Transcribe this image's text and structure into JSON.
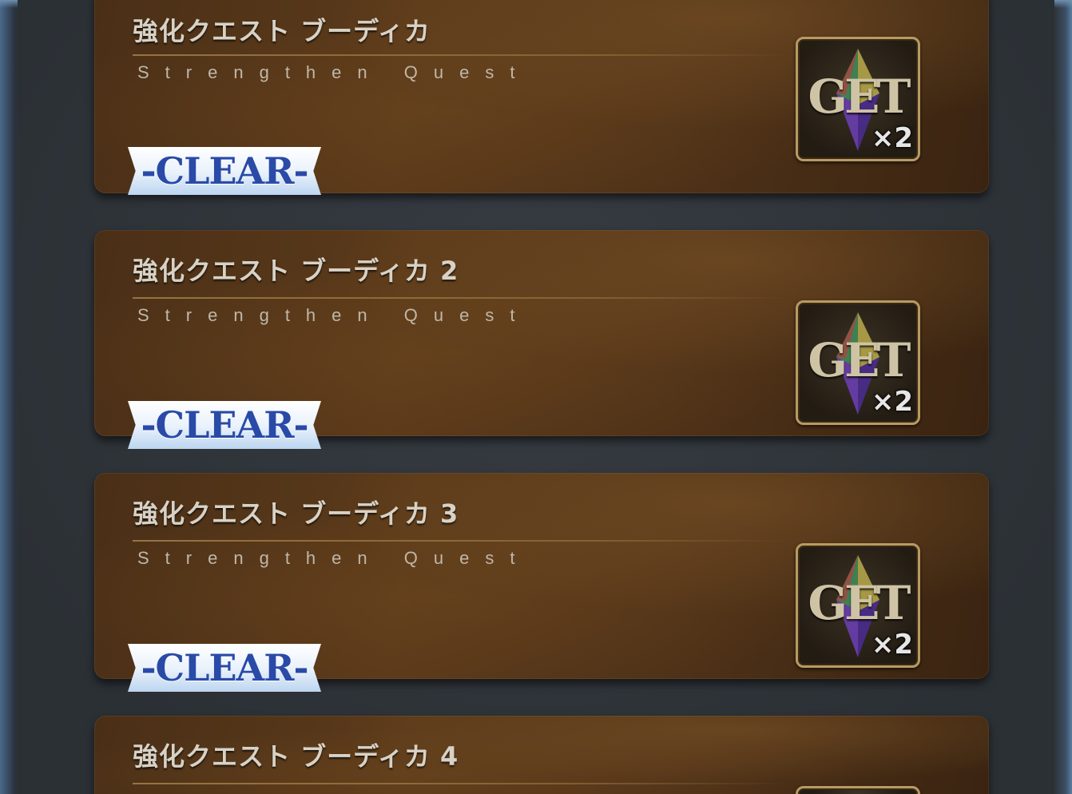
{
  "quests": [
    {
      "title": "強化クエスト ブーディカ",
      "subtitle": "Strengthen Quest",
      "status": "-CLEAR-",
      "reward_label": "GET",
      "reward_count": "×2"
    },
    {
      "title": "強化クエスト ブーディカ 2",
      "subtitle": "Strengthen Quest",
      "status": "-CLEAR-",
      "reward_label": "GET",
      "reward_count": "×2"
    },
    {
      "title": "強化クエスト ブーディカ 3",
      "subtitle": "Strengthen Quest",
      "status": "-CLEAR-",
      "reward_label": "GET",
      "reward_count": "×2"
    },
    {
      "title": "強化クエスト ブーディカ 4",
      "subtitle": "",
      "status": "",
      "reward_label": "",
      "reward_count": ""
    }
  ],
  "colors": {
    "card": "#5b3a1a",
    "clear_text": "#2a4aa8",
    "reward_border": "#b89a63"
  },
  "icons": {
    "reward": "saint-quartz-crystal-icon"
  }
}
